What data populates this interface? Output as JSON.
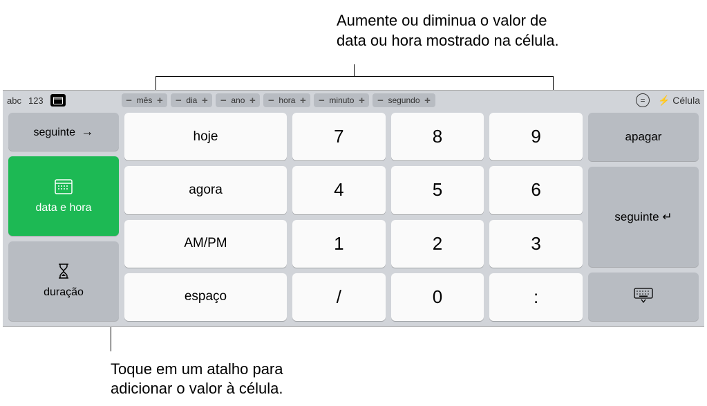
{
  "annotations": {
    "top": "Aumente ou diminua o valor de data ou hora mostrado na célula.",
    "bottom": "Toque em um atalho para adicionar o valor à célula."
  },
  "top_bar": {
    "mode_abc": "abc",
    "mode_123": "123",
    "cell_label": "Célula"
  },
  "steppers": [
    {
      "label": "mês"
    },
    {
      "label": "dia"
    },
    {
      "label": "ano"
    },
    {
      "label": "hora"
    },
    {
      "label": "minuto"
    },
    {
      "label": "segundo"
    }
  ],
  "left_keys": {
    "next_tab": "seguinte",
    "datetime": "data e hora",
    "duration": "duração"
  },
  "shortcut_keys": {
    "today": "hoje",
    "now": "agora",
    "ampm": "AM/PM",
    "space": "espaço"
  },
  "numpad": {
    "7": "7",
    "8": "8",
    "9": "9",
    "4": "4",
    "5": "5",
    "6": "6",
    "1": "1",
    "2": "2",
    "3": "3",
    "slash": "/",
    "0": "0",
    "colon": ":"
  },
  "right_keys": {
    "delete": "apagar",
    "next_cell": "seguinte"
  }
}
